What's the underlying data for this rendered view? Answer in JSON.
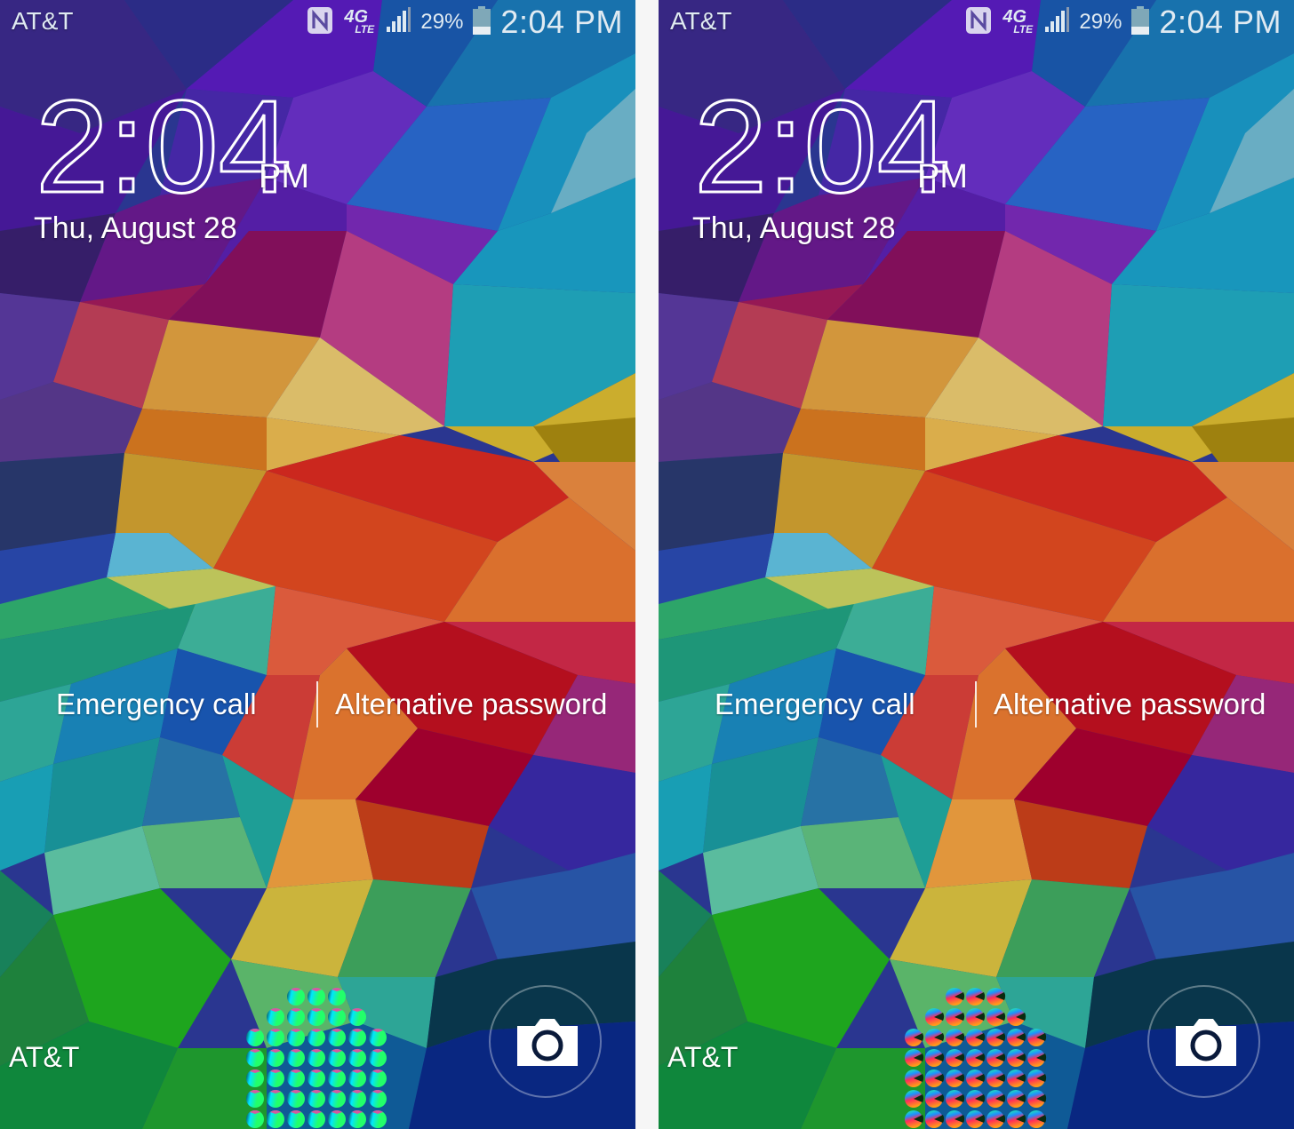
{
  "screens": [
    {
      "id": "left",
      "status_bar": {
        "carrier": "AT&T",
        "icons": [
          "nfc-icon",
          "4g-lte-icon",
          "signal-icon",
          "battery-icon"
        ],
        "network_label_top": "4G",
        "network_label_bottom": "LTE",
        "battery_percent": "29%",
        "battery_level": 0.29,
        "time": "2:04 PM"
      },
      "clock": {
        "time": "2:04",
        "ampm": "PM",
        "date": "Thu, August 28"
      },
      "actions": {
        "emergency": "Emergency call",
        "alternative": "Alternative password"
      },
      "carrier_bottom": "AT&T",
      "unlock_dots": {
        "rows": [
          3,
          5,
          7,
          7,
          7,
          7,
          7
        ],
        "style": "sphere",
        "colors": [
          "#00e6ff",
          "#22ff6a",
          "#0a3a40",
          "#d45aa0"
        ]
      },
      "camera_shortcut": "camera-icon"
    },
    {
      "id": "right",
      "status_bar": {
        "carrier": "AT&T",
        "icons": [
          "nfc-icon",
          "4g-lte-icon",
          "signal-icon",
          "battery-icon"
        ],
        "network_label_top": "4G",
        "network_label_bottom": "LTE",
        "battery_percent": "29%",
        "battery_level": 0.29,
        "time": "2:04 PM"
      },
      "clock": {
        "time": "2:04",
        "ampm": "PM",
        "date": "Thu, August 28"
      },
      "actions": {
        "emergency": "Emergency call",
        "alternative": "Alternative password"
      },
      "carrier_bottom": "AT&T",
      "unlock_dots": {
        "rows": [
          3,
          5,
          7,
          7,
          7,
          7,
          7
        ],
        "style": "rainbow-pie",
        "colors": [
          "#1e90ff",
          "#22ff9a",
          "#ff2a5a",
          "#ff9a1a",
          "#0a2a10"
        ]
      },
      "camera_shortcut": "camera-icon"
    }
  ],
  "colors": {
    "text": "#ffffff",
    "status_text": "#dfeaf2",
    "divider": "#f6f6f6"
  }
}
